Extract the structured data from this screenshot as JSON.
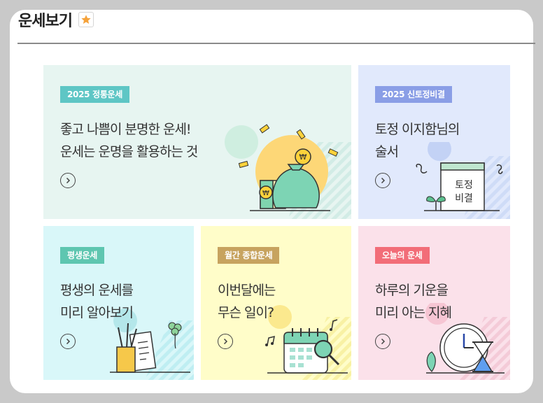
{
  "header": {
    "title": "운세보기",
    "favorite_icon": "star-icon"
  },
  "cards": [
    {
      "id": "jeongtong",
      "badge": "2025 정통운세",
      "line1": "좋고 나쁨이 분명한 운세!",
      "line2": "운세는 운명을 활용하는 것",
      "bg": "#e7f5f1",
      "badge_color": "#5ec6c5",
      "icon": "money-bag-icon"
    },
    {
      "id": "sintojeong",
      "badge": "2025 신토정비결",
      "line1": "토정 이지함님의",
      "line2": "술서",
      "bg": "#e1e9fc",
      "badge_color": "#8a9ee6",
      "icon": "book-icon",
      "book_label_1": "토정",
      "book_label_2": "비결"
    },
    {
      "id": "pyeongsaeng",
      "badge": "평생운세",
      "line1": "평생의 운세를",
      "line2": "미리 알아보기",
      "bg": "#d9f7f9",
      "badge_color": "#5ec6b0",
      "icon": "pencil-holder-icon"
    },
    {
      "id": "monthly",
      "badge": "월간 종합운세",
      "line1": "이번달에는",
      "line2": "무슨 일이?",
      "bg": "#fffdc9",
      "badge_color": "#c7a35f",
      "icon": "calendar-icon"
    },
    {
      "id": "today",
      "badge": "오늘의 운세",
      "line1": "하루의 기운을",
      "line2": "미리 아는 지혜",
      "bg": "#fbe1ea",
      "badge_color": "#f26d78",
      "icon": "clock-icon"
    }
  ]
}
